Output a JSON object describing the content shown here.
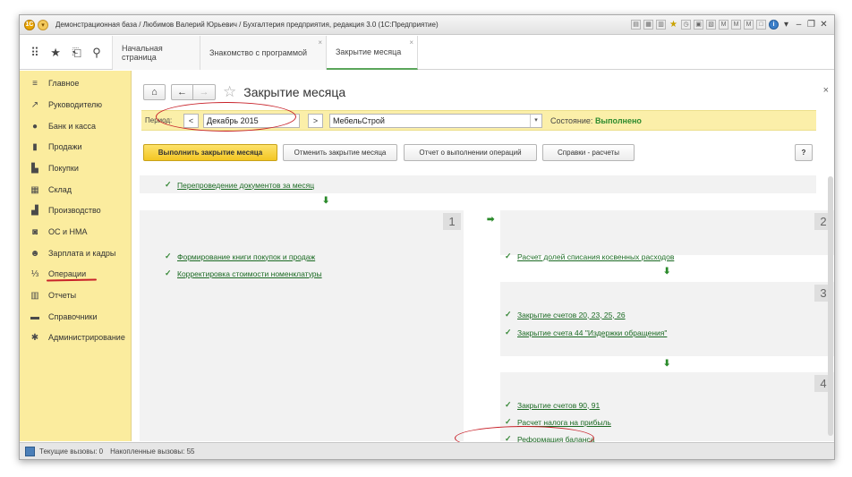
{
  "window": {
    "title": "Демонстрационная база / Любимов Валерий Юрьевич / Бухгалтерия предприятия, редакция 3.0  (1С:Предприятие)"
  },
  "toolbar": {
    "icons": [
      "apps-grid-icon",
      "star-icon",
      "history-icon",
      "search-icon"
    ],
    "tabs": [
      {
        "label": "Начальная страница",
        "active": false
      },
      {
        "label": "Знакомство с программой",
        "active": false
      },
      {
        "label": "Закрытие месяца",
        "active": true
      }
    ]
  },
  "sidebar": {
    "items": [
      {
        "label": "Главное",
        "icon": "menu-icon"
      },
      {
        "label": "Руководителю",
        "icon": "trend-icon"
      },
      {
        "label": "Банк и касса",
        "icon": "coin-icon"
      },
      {
        "label": "Продажи",
        "icon": "bag-icon"
      },
      {
        "label": "Покупки",
        "icon": "cart-icon"
      },
      {
        "label": "Склад",
        "icon": "warehouse-icon"
      },
      {
        "label": "Производство",
        "icon": "factory-icon"
      },
      {
        "label": "ОС и НМА",
        "icon": "car-icon"
      },
      {
        "label": "Зарплата и кадры",
        "icon": "people-icon"
      },
      {
        "label": "Операции",
        "icon": "operations-icon"
      },
      {
        "label": "Отчеты",
        "icon": "chart-icon"
      },
      {
        "label": "Справочники",
        "icon": "book-icon"
      },
      {
        "label": "Администрирование",
        "icon": "gear-icon"
      }
    ]
  },
  "page": {
    "title": "Закрытие месяца",
    "period_label": "Период:",
    "period_prev": "<",
    "period_value": "Декабрь 2015",
    "period_next": ">",
    "organization": "МебельСтрой",
    "state_label": "Состояние:",
    "state_value": "Выполнено"
  },
  "actions": {
    "execute": "Выполнить закрытие месяца",
    "cancel": "Отменить закрытие месяца",
    "report": "Отчет о выполнении операций",
    "refs": "Справки - расчеты",
    "help": "?"
  },
  "steps": {
    "step0": {
      "link": "Перепроведение документов за месяц"
    },
    "step1": {
      "num": "1",
      "links": [
        "Формирование книги покупок и продаж",
        "Корректировка стоимости номенклатуры"
      ]
    },
    "step2": {
      "num": "2",
      "links": [
        "Расчет долей списания косвенных расходов"
      ]
    },
    "step3": {
      "num": "3",
      "links": [
        "Закрытие счетов 20, 23, 25, 26",
        "Закрытие счета 44 \"Издержки обращения\""
      ]
    },
    "step4": {
      "num": "4",
      "links": [
        "Закрытие счетов 90, 91",
        "Расчет налога на прибыль",
        "Реформация баланса"
      ]
    }
  },
  "statusbar": {
    "current": "Текущие вызовы: 0",
    "accumulated": "Накопленные вызовы: 55"
  }
}
